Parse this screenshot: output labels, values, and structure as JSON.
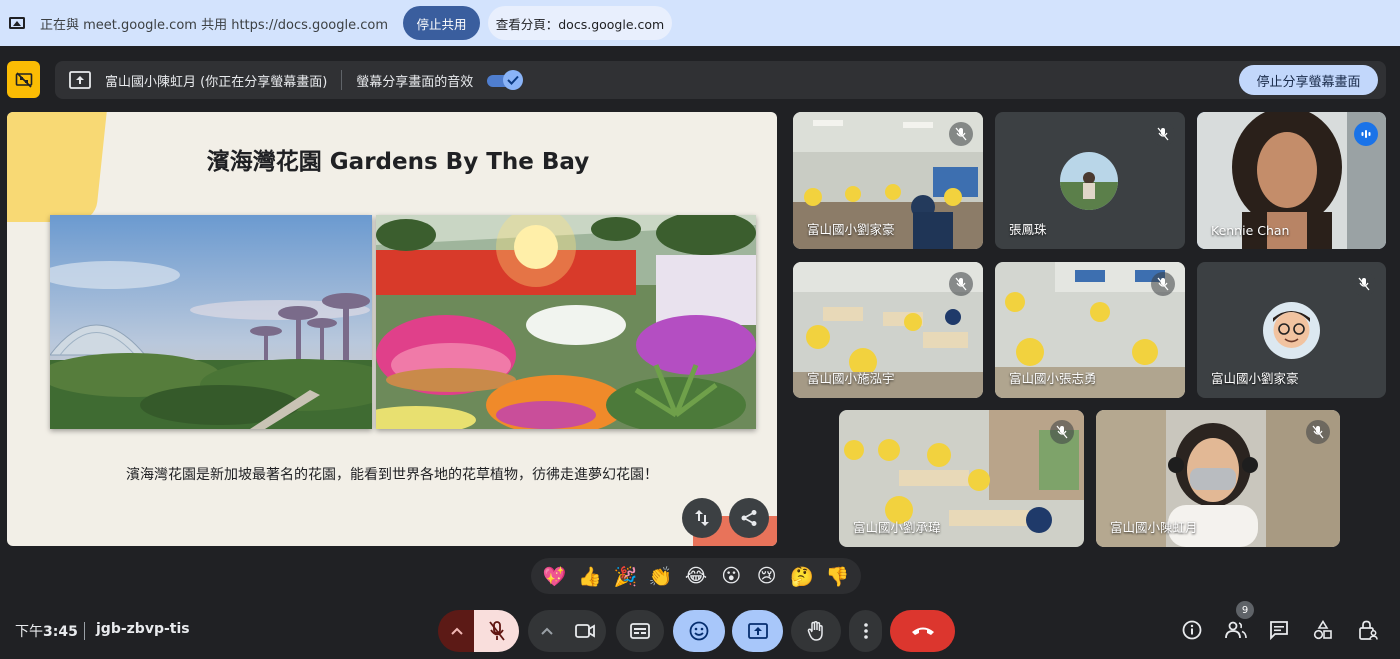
{
  "share_bar": {
    "text": "正在與 meet.google.com 共用 https://docs.google.com",
    "stop_label": "停止共用",
    "view_label": "查看分頁：docs.google.com"
  },
  "present_bar": {
    "presenter_label": "富山國小陳虹月 (你正在分享螢幕畫面)",
    "audio_label": "螢幕分享畫面的音效",
    "audio_enabled": true,
    "stop_label": "停止分享螢幕畫面"
  },
  "slide": {
    "title": "濱海灣花園 Gardens By The Bay",
    "caption": "濱海灣花園是新加坡最著名的花園，能看到世界各地的花草植物，彷彿走進夢幻花園！"
  },
  "participants": [
    {
      "name": "富山國小劉家豪",
      "muted": true
    },
    {
      "name": "張鳳珠",
      "muted": true
    },
    {
      "name": "Kennie Chan",
      "muted": false,
      "speaking": true
    },
    {
      "name": "富山國小施泓宇",
      "muted": true
    },
    {
      "name": "富山國小張志勇",
      "muted": true
    },
    {
      "name": "富山國小劉家豪",
      "muted": true
    },
    {
      "name": "富山國小劉承瑋",
      "muted": true
    },
    {
      "name": "富山國小陳虹月",
      "muted": true
    }
  ],
  "reactions": [
    "💖",
    "👍",
    "🎉",
    "👏",
    "😂",
    "😮",
    "😢",
    "🤔",
    "👎"
  ],
  "bottom": {
    "time_prefix": "下午",
    "time": "3:45",
    "meeting_code": "jgb-zbvp-tis",
    "people_count": "9"
  },
  "colors": {
    "background": "#202124",
    "accent": "#a8c7fa",
    "end_call": "#dc362e",
    "presenting_badge": "#fbbc04"
  }
}
